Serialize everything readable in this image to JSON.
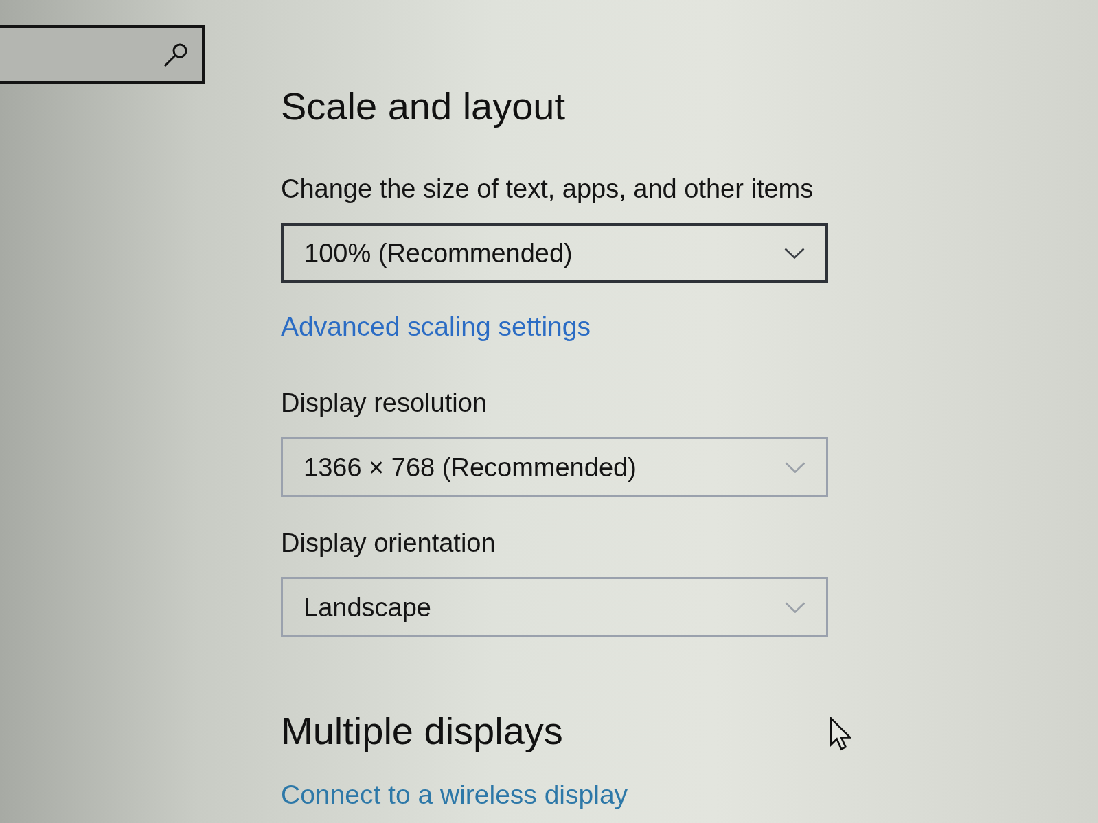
{
  "scale_and_layout": {
    "title": "Scale and layout",
    "settings": [
      {
        "kind": "dropdown",
        "label": "Change the size of text, apps, and other items",
        "value": "100% (Recommended)",
        "focused": true
      },
      {
        "kind": "link",
        "label": "Advanced scaling settings"
      },
      {
        "kind": "dropdown",
        "label": "Display resolution",
        "value": "1366 × 768 (Recommended)",
        "focused": false
      },
      {
        "kind": "dropdown",
        "label": "Display orientation",
        "value": "Landscape",
        "focused": false
      }
    ]
  },
  "multiple_displays": {
    "title": "Multiple displays",
    "settings": [
      {
        "kind": "link",
        "label": "Connect to a wireless display"
      }
    ]
  }
}
